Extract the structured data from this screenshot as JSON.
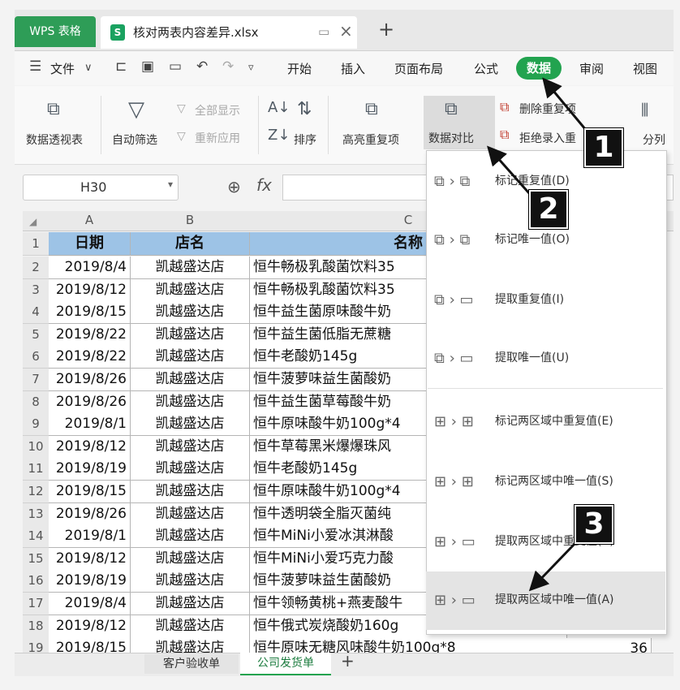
{
  "tabs": {
    "app": "WPS 表格",
    "file": "核对两表内容差异.xlsx",
    "new": "+"
  },
  "menu": {
    "file": "文件",
    "items": [
      "开始",
      "插入",
      "页面布局",
      "公式",
      "数据",
      "审阅",
      "视图"
    ]
  },
  "ribbon": {
    "pivot": "数据透视表",
    "autofilter": "自动筛选",
    "show_all": "全部显示",
    "reapply": "重新应用",
    "sort": "排序",
    "highlight_dup": "高亮重复项",
    "compare": "数据对比",
    "remove_dup": "删除重复项",
    "reject_dup": "拒绝录入重",
    "split": "分列"
  },
  "formula": {
    "cell_ref": "H30",
    "fx": "fx"
  },
  "grid": {
    "columns": [
      "A",
      "B",
      "C"
    ],
    "header": [
      "日期",
      "店名",
      "名称"
    ],
    "rows": [
      {
        "n": "2",
        "date": "2019/8/4",
        "store": "凯越盛达店",
        "name": "恒牛畅极乳酸菌饮料35"
      },
      {
        "n": "3",
        "date": "2019/8/12",
        "store": "凯越盛达店",
        "name": "恒牛畅极乳酸菌饮料35"
      },
      {
        "n": "4",
        "date": "2019/8/15",
        "store": "凯越盛达店",
        "name": "恒牛益生菌原味酸牛奶"
      },
      {
        "n": "5",
        "date": "2019/8/22",
        "store": "凯越盛达店",
        "name": "恒牛益生菌低脂无蔗糖"
      },
      {
        "n": "6",
        "date": "2019/8/22",
        "store": "凯越盛达店",
        "name": "恒牛老酸奶145g"
      },
      {
        "n": "7",
        "date": "2019/8/26",
        "store": "凯越盛达店",
        "name": "恒牛菠萝味益生菌酸奶"
      },
      {
        "n": "8",
        "date": "2019/8/26",
        "store": "凯越盛达店",
        "name": "恒牛益生菌草莓酸牛奶"
      },
      {
        "n": "9",
        "date": "2019/8/1",
        "store": "凯越盛达店",
        "name": "恒牛原味酸牛奶100g*4"
      },
      {
        "n": "10",
        "date": "2019/8/12",
        "store": "凯越盛达店",
        "name": "恒牛草莓黑米爆爆珠风"
      },
      {
        "n": "11",
        "date": "2019/8/19",
        "store": "凯越盛达店",
        "name": "恒牛老酸奶145g"
      },
      {
        "n": "12",
        "date": "2019/8/15",
        "store": "凯越盛达店",
        "name": "恒牛原味酸牛奶100g*4"
      },
      {
        "n": "13",
        "date": "2019/8/26",
        "store": "凯越盛达店",
        "name": "恒牛透明袋全脂灭菌纯"
      },
      {
        "n": "14",
        "date": "2019/8/1",
        "store": "凯越盛达店",
        "name": "恒牛MiNi小爱冰淇淋酸"
      },
      {
        "n": "15",
        "date": "2019/8/12",
        "store": "凯越盛达店",
        "name": "恒牛MiNi小爱巧克力酸"
      },
      {
        "n": "16",
        "date": "2019/8/19",
        "store": "凯越盛达店",
        "name": "恒牛菠萝味益生菌酸奶"
      },
      {
        "n": "17",
        "date": "2019/8/4",
        "store": "凯越盛达店",
        "name": "恒牛领畅黄桃+燕麦酸牛"
      },
      {
        "n": "18",
        "date": "2019/8/12",
        "store": "凯越盛达店",
        "name": "恒牛俄式炭烧酸奶160g"
      },
      {
        "n": "19",
        "date": "2019/8/15",
        "store": "凯越盛达店",
        "name": "恒牛原味无糖风味酸牛奶100g*8"
      }
    ],
    "row19_value": "36"
  },
  "dropdown": [
    "标记重复值(D)",
    "标记唯一值(O)",
    "提取重复值(I)",
    "提取唯一值(U)",
    "标记两区域中重复值(E)",
    "标记两区域中唯一值(S)",
    "提取两区域中重复值(R)",
    "提取两区域中唯一值(A)"
  ],
  "sheets": [
    "客户验收单",
    "公司发货单"
  ],
  "callouts": [
    "1",
    "2",
    "3"
  ],
  "colors": {
    "accent": "#22a34f",
    "header_fill": "#9dc3e6",
    "callout": "#111111"
  }
}
